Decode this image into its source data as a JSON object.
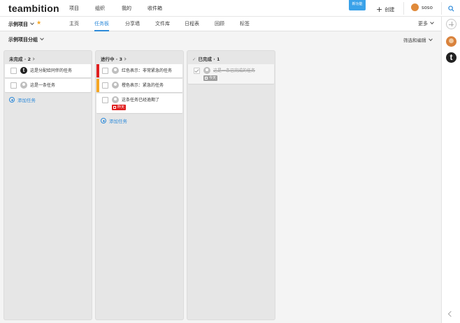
{
  "app": {
    "logo": "teambition"
  },
  "topnav": [
    {
      "label": "项目"
    },
    {
      "label": "组织"
    },
    {
      "label": "我的"
    },
    {
      "label": "收件箱"
    }
  ],
  "top_right": {
    "new_version": "新功能",
    "create": "创建",
    "username": "soso"
  },
  "project": {
    "name": "示例项目",
    "starred": true
  },
  "tabs": [
    {
      "label": "主页",
      "active": false
    },
    {
      "label": "任务板",
      "active": true
    },
    {
      "label": "分享墙",
      "active": false
    },
    {
      "label": "文件库",
      "active": false
    },
    {
      "label": "日程表",
      "active": false
    },
    {
      "label": "回顾",
      "active": false
    },
    {
      "label": "标签",
      "active": false
    }
  ],
  "more_label": "更多",
  "group": {
    "name": "示例项目分组",
    "filter_label": "筛选和编辑"
  },
  "columns": [
    {
      "title": "未完成 · 2",
      "tasks": [
        {
          "title": "这是分配给同伴的任务",
          "avatar": "t",
          "done": false
        },
        {
          "title": "这是一条任务",
          "avatar": "default",
          "done": false
        }
      ],
      "add_label": "添加任务"
    },
    {
      "title": "进行中 · 3",
      "tasks": [
        {
          "title": "红色表示：非常紧急的任务",
          "priority_color": "#e02020",
          "done": false
        },
        {
          "title": "橙色表示：紧急的任务",
          "priority_color": "#f5a623",
          "done": false
        },
        {
          "title": "这条任务已经逾期了",
          "done": false,
          "date": "昨天",
          "date_color": "#e02020"
        }
      ],
      "add_label": "添加任务"
    },
    {
      "title": "已完成 · 1",
      "tasks": [
        {
          "title": "这是一条已完成的任务",
          "done": true,
          "date": "今天",
          "date_color": "#9e9e9e"
        }
      ]
    }
  ],
  "colors": {
    "accent": "#2d8ad9",
    "urgent": "#e02020",
    "warning": "#f5a623"
  }
}
